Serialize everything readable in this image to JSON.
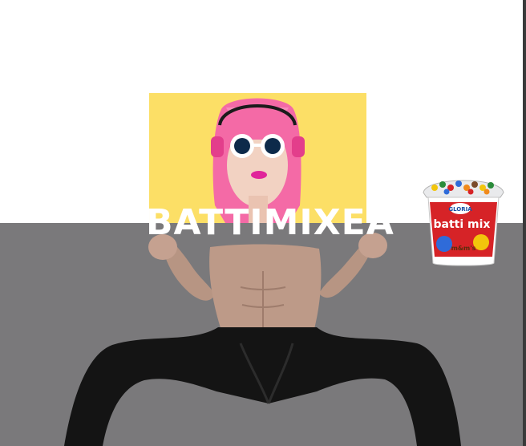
{
  "hero": {
    "headline": "BATTIMIXEA"
  },
  "product": {
    "brand_label": "GLORIA",
    "name_label": "batti mix",
    "candy_label": "m&m's"
  },
  "colors": {
    "yellow_card": "#fcdf66",
    "grey_panel": "#7a797b",
    "hair_pink": "#f46aa6",
    "cup_red": "#d62327",
    "headline": "#ffffff"
  }
}
